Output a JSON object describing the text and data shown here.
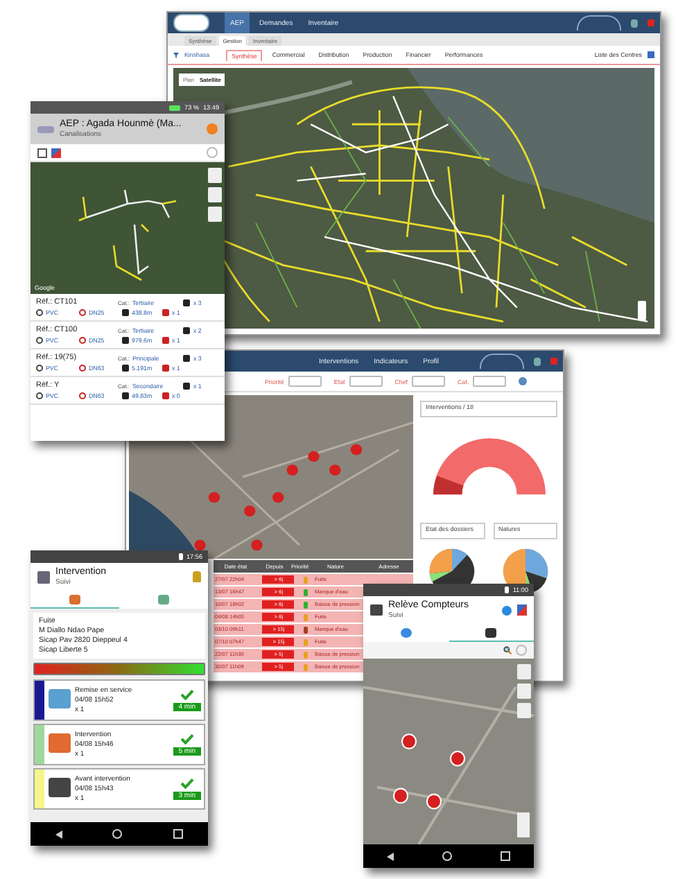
{
  "gis_window": {
    "nav": [
      {
        "label": "AEP",
        "selected": true
      },
      {
        "label": "Demandes",
        "selected": false
      },
      {
        "label": "Inventaire",
        "selected": false
      }
    ],
    "subtabs": [
      {
        "label": "Synthèse",
        "selected": false
      },
      {
        "label": "Gestion",
        "selected": true
      },
      {
        "label": "Inventaire",
        "selected": false
      }
    ],
    "region_filter": "Kinshasa",
    "sections": [
      {
        "label": "Synthèse",
        "selected": true
      },
      {
        "label": "Commercial",
        "selected": false
      },
      {
        "label": "Distribution",
        "selected": false
      },
      {
        "label": "Production",
        "selected": false
      },
      {
        "label": "Financier",
        "selected": false
      },
      {
        "label": "Performances",
        "selected": false
      }
    ],
    "centres_link": "Liste des Centres",
    "map_types": [
      {
        "label": "Plan",
        "selected": false
      },
      {
        "label": "Satellite",
        "selected": true
      }
    ]
  },
  "interventions_window": {
    "nav": [
      "Interventions",
      "Indicateurs",
      "Profil"
    ],
    "filters": [
      "Priorité",
      "Etat",
      "Chef",
      "Cat."
    ],
    "panel_search": "Interventions / 18",
    "chart_searches": [
      "Etat des dossiers",
      "Natures"
    ],
    "table": {
      "columns": [
        "Date état",
        "Depuis",
        "Priorité",
        "Nature",
        "Adresse"
      ],
      "rows": [
        {
          "date": "27/07 22h04",
          "since": "> 6j",
          "color": "#e8a020",
          "nature": "Fuite"
        },
        {
          "date": "13/07 16h47",
          "since": "> 6j",
          "color": "#30b030",
          "nature": "Manque d'eau"
        },
        {
          "date": "10/07 18h02",
          "since": "> 6j",
          "color": "#30b030",
          "nature": "Baisse de pression"
        },
        {
          "date": "04/08 14h05",
          "since": "> 6j",
          "color": "#e8a020",
          "nature": "Fuite"
        },
        {
          "date": "03/10 09h11",
          "since": "> 15j",
          "color": "#a04020",
          "nature": "Manque d'eau"
        },
        {
          "date": "07/10 07h47",
          "since": "> 15j",
          "color": "#e8a020",
          "nature": "Fuite"
        },
        {
          "date": "22/07 11h30",
          "since": "> 5j",
          "color": "#e8a020",
          "nature": "Baisse de pression"
        },
        {
          "date": "30/07 11h09",
          "since": "> 5j",
          "color": "#e8a020",
          "nature": "Baisse de pression"
        }
      ]
    }
  },
  "network_phone": {
    "select_all": {
      "checked": false
    },
    "battery": "73 %",
    "time": "13:49",
    "title": "AEP : Agada Hounmè (Ma...",
    "subtitle": "Canalisations",
    "map_credit": "Google",
    "pipes": [
      {
        "ref": "Réf.: CT101",
        "cat_label": "Cat.:",
        "category": "Tertiaire",
        "valves": "x 3",
        "material": "PVC",
        "diameter": "DN25",
        "length": "438.8m",
        "leaks": "x 1"
      },
      {
        "ref": "Réf.: CT100",
        "cat_label": "Cat.:",
        "category": "Tertiaire",
        "valves": "x 2",
        "material": "PVC",
        "diameter": "DN25",
        "length": "979.6m",
        "leaks": "x 1"
      },
      {
        "ref": "Réf.: 19(75)",
        "cat_label": "Cat.:",
        "category": "Principale",
        "valves": "x 3",
        "material": "PVC",
        "diameter": "DN63",
        "length": "5.191m",
        "leaks": "x 1"
      },
      {
        "ref": "Réf.: Y",
        "cat_label": "Cat.:",
        "category": "Secondaire",
        "valves": "x 1",
        "material": "PVC",
        "diameter": "DN63",
        "length": "49.83m",
        "leaks": "x 0"
      }
    ]
  },
  "intervention_phone": {
    "time": "17:56",
    "title": "Intervention",
    "subtitle": "Suivi",
    "tabs": [
      {
        "selected": true
      },
      {
        "selected": false
      }
    ],
    "details": [
      "Fuite",
      "M Diallo Ndao Pape",
      "Sicap Pav 2820 Dieppeul 4",
      "Sicap Liberte 5"
    ],
    "progress": {
      "level": 1
    },
    "steps": [
      {
        "title": "Remise en service",
        "time": "04/08 15h52",
        "count": "x 1",
        "duration": "4 min",
        "color": "#1a1a90"
      },
      {
        "title": "Intervention",
        "time": "04/08 15h46",
        "count": "x 1",
        "duration": "5 min",
        "color": "#9ed89a"
      },
      {
        "title": "Avant intervention",
        "time": "04/08 15h43",
        "count": "x 1",
        "duration": "3 min",
        "color": "#f5f58a"
      }
    ]
  },
  "meter_phone": {
    "time": "11:00",
    "title": "Relève Compteurs",
    "subtitle": "Suivi",
    "tabs": [
      {
        "selected": false
      },
      {
        "selected": true
      }
    ]
  }
}
